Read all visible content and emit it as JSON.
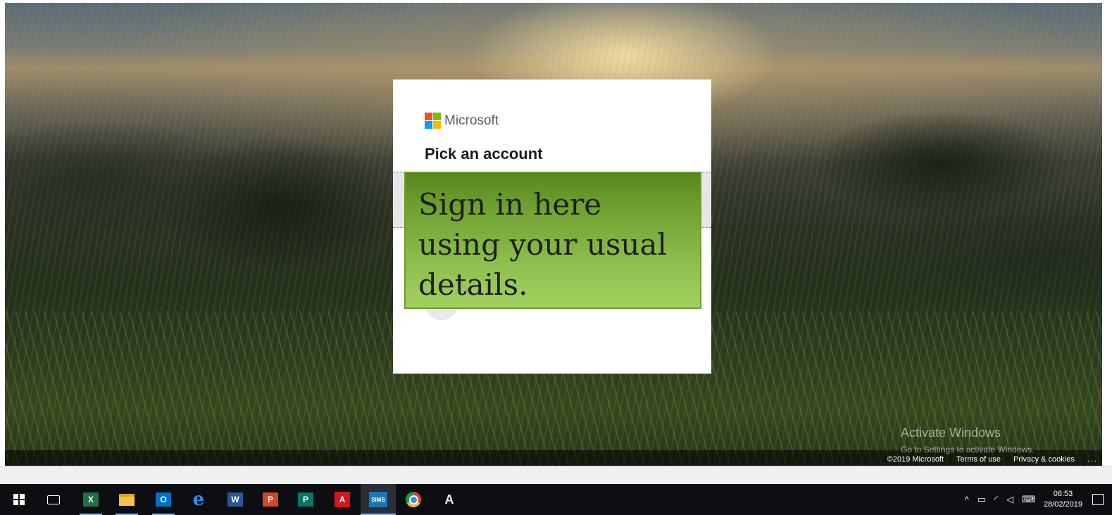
{
  "dialog": {
    "brand": "Microsoft",
    "title": "Pick an account",
    "add_symbol": "+"
  },
  "callout": {
    "lines": [
      "Sign in here",
      "using your usual",
      "details."
    ]
  },
  "watermark": {
    "line1": "Activate Windows",
    "line2": "Go to Settings to activate Windows."
  },
  "footer": {
    "copyright": "©2019 Microsoft",
    "terms": "Terms of use",
    "privacy": "Privacy & cookies",
    "more": "..."
  },
  "taskbar": {
    "apps": [
      {
        "icon": "start-icon"
      },
      {
        "icon": "task-view-icon"
      },
      {
        "icon": "excel-icon",
        "label": "X"
      },
      {
        "icon": "file-explorer-icon"
      },
      {
        "icon": "outlook-icon",
        "label": "O"
      },
      {
        "icon": "edge-icon",
        "label": "e"
      },
      {
        "icon": "word-icon",
        "label": "W"
      },
      {
        "icon": "powerpoint-icon",
        "label": "P"
      },
      {
        "icon": "publisher-icon",
        "label": "P"
      },
      {
        "icon": "acrobat-icon",
        "label": "A"
      },
      {
        "icon": "sims-icon",
        "label": "SIMS"
      },
      {
        "icon": "chrome-icon"
      },
      {
        "icon": "app-icon",
        "label": "A"
      }
    ],
    "tray": {
      "chevron": "^",
      "time": "08:53",
      "date": "28/02/2019"
    }
  },
  "colors": {
    "ms_red": "#f25022",
    "ms_green": "#7fba00",
    "ms_blue": "#00a4ef",
    "ms_yellow": "#ffb900",
    "callout_green": "#6fa02f",
    "taskbar_bg": "#0c0e12"
  }
}
